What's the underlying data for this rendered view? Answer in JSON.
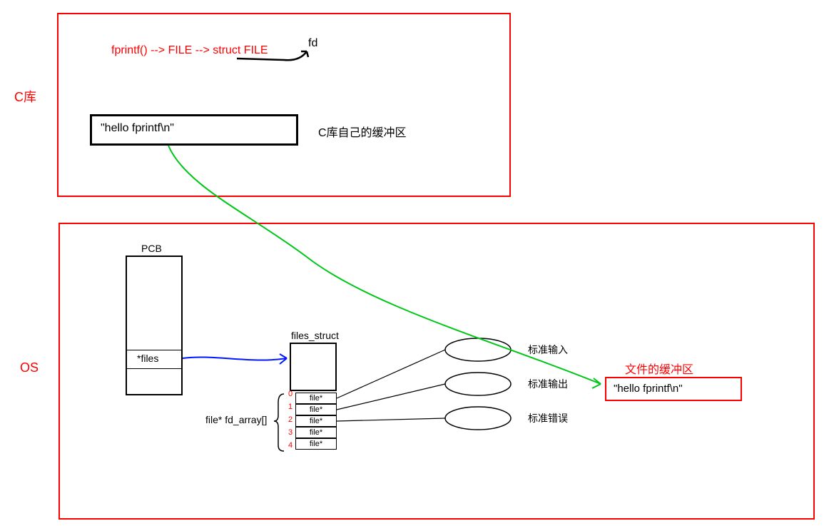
{
  "labels": {
    "c_lib": "C库",
    "os": "OS"
  },
  "top": {
    "chain": "fprintf() --> FILE --> struct FILE",
    "fd": "fd",
    "buffer_text": "\"hello fprintf\\n\"",
    "buffer_label": "C库自己的缓冲区"
  },
  "pcb": {
    "title": "PCB",
    "field": "*files"
  },
  "files_struct": {
    "title": "files_struct",
    "array_label": "file* fd_array[]",
    "indices": [
      "0",
      "1",
      "2",
      "3",
      "4"
    ],
    "rows": [
      "file*",
      "file*",
      "file*",
      "file*",
      "file*"
    ]
  },
  "streams": {
    "stdin": "标准输入",
    "stdout": "标准输出",
    "stderr": "标准错误"
  },
  "file_buffer": {
    "title": "文件的缓冲区",
    "text": "\"hello fprintf\\n\""
  }
}
